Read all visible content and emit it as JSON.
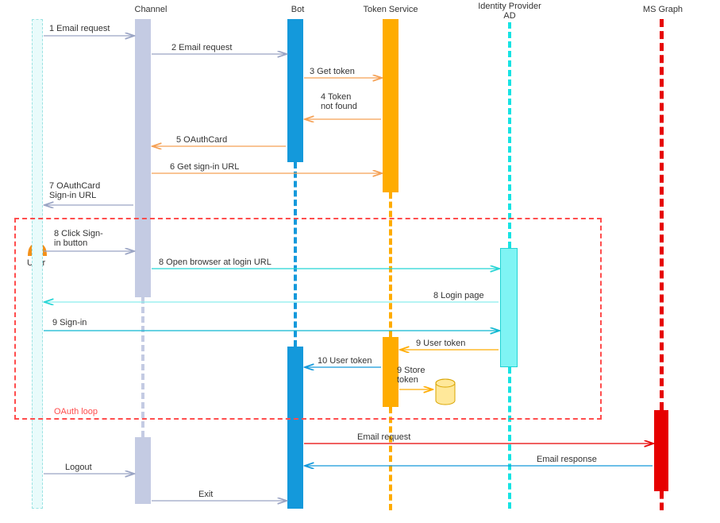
{
  "participants": {
    "user": {
      "label": "User"
    },
    "channel": {
      "label": "Channel"
    },
    "bot": {
      "label": "Bot"
    },
    "token_service": {
      "label": "Token Service"
    },
    "idp": {
      "label": "Identity Provider\nAD"
    },
    "ms_graph": {
      "label": "MS Graph"
    }
  },
  "messages": {
    "m1": "1 Email request",
    "m2": "2 Email request",
    "m3": "3 Get token",
    "m4": "4 Token\nnot found",
    "m5": "5 OAuthCard",
    "m6": "6 Get sign-in URL",
    "m7": "7 OAuthCard\nSign-in URL",
    "m8a": "8 Click Sign-\nin button",
    "m8b": "8 Open browser at login URL",
    "m8c": "8 Login page",
    "m9a": "9 Sign-in",
    "m9b": "9 User token",
    "m9c": "9 Store\ntoken",
    "m10": "10 User token",
    "mreq": "Email request",
    "mresp": "Email response",
    "mlogout": "Logout",
    "mexit": "Exit"
  },
  "oauth_loop_label": "OAuth loop",
  "chart_data": {
    "type": "sequence-diagram",
    "participants": [
      "User",
      "Channel",
      "Bot",
      "Token Service",
      "Identity Provider AD",
      "MS Graph"
    ],
    "loop": {
      "name": "OAuth loop",
      "range": [
        "8 Click Sign-in button",
        "9 Store token"
      ]
    },
    "messages": [
      {
        "n": 1,
        "from": "User",
        "to": "Channel",
        "label": "Email request"
      },
      {
        "n": 2,
        "from": "Channel",
        "to": "Bot",
        "label": "Email request"
      },
      {
        "n": 3,
        "from": "Bot",
        "to": "Token Service",
        "label": "Get token"
      },
      {
        "n": 4,
        "from": "Token Service",
        "to": "Bot",
        "label": "Token not found"
      },
      {
        "n": 5,
        "from": "Bot",
        "to": "Channel",
        "label": "OAuthCard"
      },
      {
        "n": 6,
        "from": "Channel",
        "to": "Token Service",
        "label": "Get sign-in URL"
      },
      {
        "n": 7,
        "from": "Channel",
        "to": "User",
        "label": "OAuthCard Sign-in URL"
      },
      {
        "n": 8,
        "from": "User",
        "to": "Channel",
        "label": "Click Sign-in button"
      },
      {
        "n": 8,
        "from": "Channel",
        "to": "Identity Provider AD",
        "label": "Open browser at login URL"
      },
      {
        "n": 8,
        "from": "Identity Provider AD",
        "to": "User",
        "label": "Login page"
      },
      {
        "n": 9,
        "from": "User",
        "to": "Identity Provider AD",
        "label": "Sign-in"
      },
      {
        "n": 9,
        "from": "Identity Provider AD",
        "to": "Token Service",
        "label": "User token"
      },
      {
        "n": 9,
        "from": "Token Service",
        "to": "Token Service",
        "label": "Store token"
      },
      {
        "n": 10,
        "from": "Token Service",
        "to": "Bot",
        "label": "User token"
      },
      {
        "from": "Bot",
        "to": "MS Graph",
        "label": "Email request"
      },
      {
        "from": "MS Graph",
        "to": "Bot",
        "label": "Email response"
      },
      {
        "from": "User",
        "to": "Channel",
        "label": "Logout"
      },
      {
        "from": "Channel",
        "to": "Bot",
        "label": "Exit"
      }
    ]
  }
}
